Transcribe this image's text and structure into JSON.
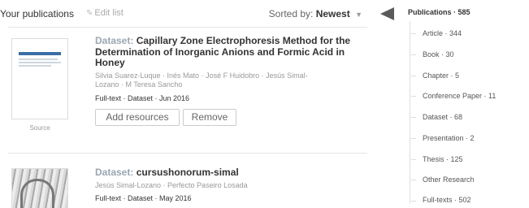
{
  "header": {
    "title": "Your publications",
    "edit_list": "Edit list",
    "sorted_label": "Sorted by:",
    "sorted_value": "Newest"
  },
  "publications": [
    {
      "type": "Dataset:",
      "title_line1": "Capillary Zone Electrophoresis Method for the",
      "title_line2": "Determination of Inorganic Anions and Formic Acid in",
      "title_line3": "Honey",
      "authors_line1": "Silvia Suarez-Luque · Inés Mato · José F Huidobro · Jesús Simal-",
      "authors_line2": "Lozano · M Teresa Sancho",
      "meta": "Full-text · Dataset · Jun 2016",
      "thumb_caption": "Source",
      "add_label": "Add resources",
      "remove_label": "Remove"
    },
    {
      "type": "Dataset:",
      "title_line1": "cursushonorum-simal",
      "authors_line1": "Jesús Simal-Lozano · Perfecto Paseiro Losada",
      "meta": "Full-text · Dataset · May 2016"
    }
  ],
  "sidebar": {
    "title": "Publications · 585",
    "items": [
      {
        "label": "Article · 344"
      },
      {
        "label": "Book · 30"
      },
      {
        "label": "Chapter · 5"
      },
      {
        "label": "Conference Paper · 11"
      },
      {
        "label": "Dataset · 68"
      },
      {
        "label": "Presentation · 2"
      },
      {
        "label": "Thesis · 125"
      },
      {
        "label": "Other Research"
      },
      {
        "label": "Full-texts · 502"
      }
    ]
  },
  "colors": {
    "type_prefix": "#9aa6b2",
    "sidebar_arrow": "#5a5a5a",
    "muted_text": "#999999"
  },
  "icons": {
    "edit": "pencil-icon",
    "sort": "caret-down-icon",
    "collapse": "triangle-left-icon"
  }
}
